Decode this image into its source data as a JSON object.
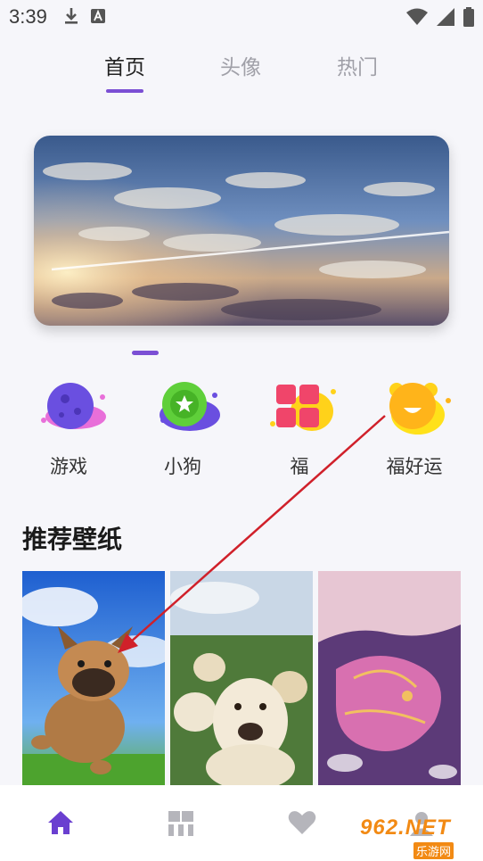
{
  "status_bar": {
    "time": "3:39",
    "icons": [
      "download-icon",
      "a-badge-icon",
      "wifi-icon",
      "signal-icon",
      "battery-icon"
    ]
  },
  "top_tabs": [
    {
      "label": "首页",
      "active": true
    },
    {
      "label": "头像",
      "active": false
    },
    {
      "label": "热门",
      "active": false
    }
  ],
  "banner": {
    "image": "sky-clouds-wallpaper",
    "active_page": 1
  },
  "categories": [
    {
      "label": "游戏",
      "icon": "planet-icon"
    },
    {
      "label": "小狗",
      "icon": "star-badge-icon"
    },
    {
      "label": "福",
      "icon": "grid-tiles-icon"
    },
    {
      "label": "福好运",
      "icon": "bear-face-icon"
    }
  ],
  "section": {
    "title": "推荐壁纸"
  },
  "wallpapers": [
    {
      "subject": "bulldog-sky-wallpaper"
    },
    {
      "subject": "labradors-field-wallpaper"
    },
    {
      "subject": "pink-dragon-wallpaper"
    }
  ],
  "bottom_nav": [
    {
      "icon": "home-icon",
      "active": true
    },
    {
      "icon": "category-grid-icon",
      "active": false
    },
    {
      "icon": "heart-icon",
      "active": false
    },
    {
      "icon": "profile-icon",
      "active": false
    }
  ],
  "watermark": {
    "top": "962.NET",
    "bottom": "乐游网"
  },
  "colors": {
    "accent": "#7b4fd4",
    "background": "#f6f6fa",
    "annotation": "#d0202a"
  }
}
